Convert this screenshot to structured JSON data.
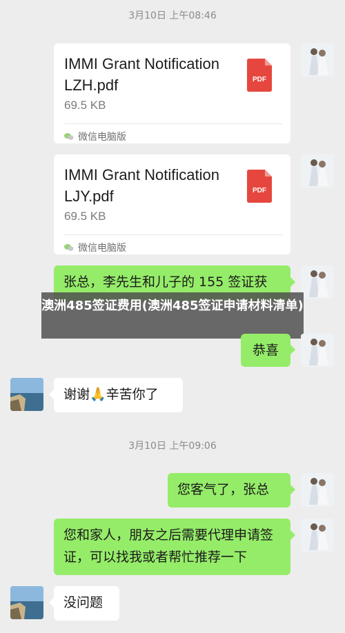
{
  "timestamps": [
    "3月10日 上午08:46",
    "3月10日 上午09:06"
  ],
  "files": [
    {
      "name": "IMMI Grant Notification LZH.pdf",
      "size": "69.5 KB",
      "source": "微信电脑版",
      "type_label": "PDF"
    },
    {
      "name": "IMMI Grant Notification LJY.pdf",
      "size": "69.5 KB",
      "source": "微信电脑版",
      "type_label": "PDF"
    }
  ],
  "messages": [
    {
      "side": "me",
      "text": "张总，李先生和儿子的 155 签证获"
    },
    {
      "side": "me",
      "text": "恭喜"
    },
    {
      "side": "other",
      "text": "谢谢🙏辛苦你了"
    },
    {
      "side": "me",
      "text": "您客气了，张总"
    },
    {
      "side": "me",
      "text": "您和家人，朋友之后需要代理申请签证，可以找我或者帮忙推荐一下"
    },
    {
      "side": "other",
      "text": "没问题"
    }
  ],
  "banner": {
    "text": "澳洲485签证费用(澳洲485签证申请材料清单)"
  },
  "colors": {
    "my_bubble": "#95ec69",
    "their_bubble": "#ffffff",
    "background": "#ededed",
    "pdf_icon": "#e5473e"
  }
}
